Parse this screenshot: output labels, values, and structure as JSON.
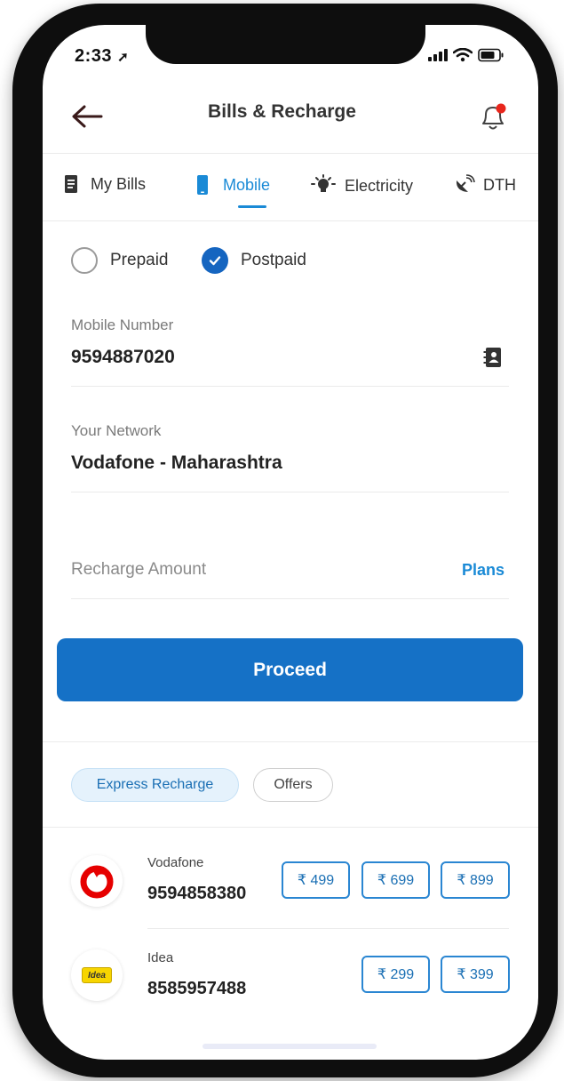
{
  "status_bar": {
    "time": "2:33"
  },
  "header": {
    "title": "Bills & Recharge"
  },
  "tabs": [
    {
      "label": "My Bills",
      "icon": "document-icon",
      "active": false
    },
    {
      "label": "Mobile",
      "icon": "mobile-phone-icon",
      "active": true
    },
    {
      "label": "Electricity",
      "icon": "bulb-icon",
      "active": false
    },
    {
      "label": "DTH",
      "icon": "satellite-dish-icon",
      "active": false
    }
  ],
  "plan_type": {
    "options": [
      {
        "label": "Prepaid",
        "selected": false
      },
      {
        "label": "Postpaid",
        "selected": true
      }
    ]
  },
  "form": {
    "mobile_label": "Mobile Number",
    "mobile_value": "9594887020",
    "network_label": "Your Network",
    "network_value": "Vodafone - Maharashtra",
    "amount_placeholder": "Recharge Amount",
    "plans_link": "Plans"
  },
  "proceed_label": "Proceed",
  "chips": [
    {
      "label": "Express Recharge",
      "active": true
    },
    {
      "label": "Offers",
      "active": false
    }
  ],
  "express": [
    {
      "operator": "Vodafone",
      "number": "9594858380",
      "logo": "vodafone-logo",
      "amounts": [
        "₹ 499",
        "₹ 699",
        "₹ 899"
      ]
    },
    {
      "operator": "Idea",
      "number": "8585957488",
      "logo": "idea-logo",
      "logo_text": "Idea",
      "amounts": [
        "₹ 299",
        "₹ 399"
      ]
    }
  ],
  "colors": {
    "accent": "#1a8ad6",
    "button": "#1571c6",
    "notification_dot": "#e8261c",
    "vodafone_red": "#e60000",
    "idea_yellow": "#f7d500"
  }
}
